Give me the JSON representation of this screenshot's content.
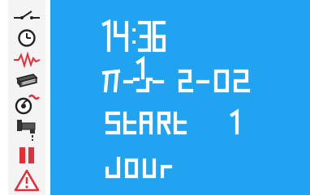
{
  "status_icons": [
    {
      "name": "switch-icon",
      "color": "#222222"
    },
    {
      "name": "clock-icon",
      "color": "#222222"
    },
    {
      "name": "heartbeat-icon",
      "color": "#e0303a"
    },
    {
      "name": "vent-icon",
      "color": "#333333"
    },
    {
      "name": "fan-icon",
      "color": "#e0303a"
    },
    {
      "name": "tap-icon",
      "color": "#222222"
    },
    {
      "name": "pause-icon",
      "color": "#e0303a"
    },
    {
      "name": "warning-icon",
      "color": "#e0303a"
    }
  ],
  "display": {
    "time": "14:36",
    "date": "m-1-2-02",
    "mode": "StARt 1",
    "day": "JOUr",
    "background": "#20a4f2",
    "segment_color": "#ffffff"
  }
}
